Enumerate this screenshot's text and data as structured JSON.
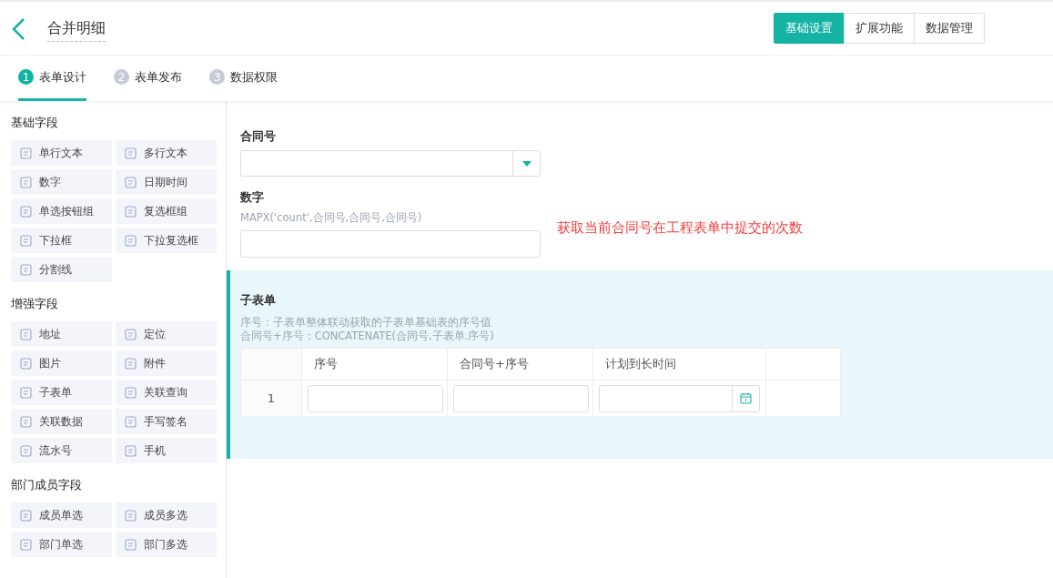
{
  "header": {
    "title": "合并明细",
    "buttons": [
      {
        "label": "基础设置",
        "selected": true
      },
      {
        "label": "扩展功能",
        "selected": false
      },
      {
        "label": "数据管理",
        "selected": false
      }
    ]
  },
  "steps": [
    {
      "number": "1",
      "label": "表单设计",
      "selected": true
    },
    {
      "number": "2",
      "label": "表单发布",
      "selected": false
    },
    {
      "number": "3",
      "label": "数据权限",
      "selected": false
    }
  ],
  "sidebar": {
    "groups": [
      {
        "title": "基础字段",
        "items": [
          "单行文本",
          "多行文本",
          "数字",
          "日期时间",
          "单选按钮组",
          "复选框组",
          "下拉框",
          "下拉复选框",
          "分割线"
        ]
      },
      {
        "title": "增强字段",
        "items": [
          "地址",
          "定位",
          "图片",
          "附件",
          "子表单",
          "关联查询",
          "关联数据",
          "手写签名",
          "流水号",
          "手机"
        ]
      },
      {
        "title": "部门成员字段",
        "items": [
          "成员单选",
          "成员多选",
          "部门单选",
          "部门多选"
        ]
      }
    ]
  },
  "form": {
    "fields": [
      {
        "kind": "select",
        "label": "合同号"
      },
      {
        "kind": "input",
        "label": "数字",
        "hint": "MAPX('count',合同号,合同号,合同号)",
        "note": "获取当前合同号在工程表单中提交的次数"
      }
    ],
    "subform": {
      "title": "子表单",
      "hints": [
        "序号：子表单整体联动获取的子表单基础表的序号值",
        "合同号+序号：CONCATENATE(合同号,子表单.序号)"
      ],
      "columns": [
        {
          "label": "序号",
          "kind": "input"
        },
        {
          "label": "合同号+序号",
          "kind": "input"
        },
        {
          "label": "计划到长时间",
          "kind": "date"
        }
      ],
      "rows": [
        {
          "index": "1"
        }
      ]
    }
  }
}
